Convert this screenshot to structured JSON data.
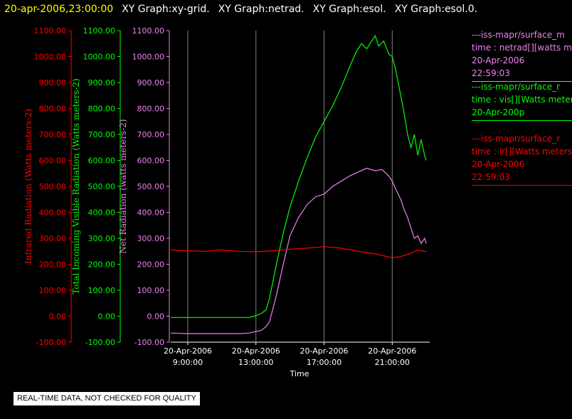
{
  "header": {
    "title": "20-apr-2006,23:00:00",
    "graph_names": [
      "XY Graph:xy-grid.",
      "XY Graph:netrad.",
      "XY Graph:esol.",
      "XY Graph:esol.0."
    ]
  },
  "colors": {
    "background": "#000000",
    "title": "#ffff00",
    "infrared": "#ff0000",
    "visible": "#00ff00",
    "net": "#ee82ee",
    "axis": "#ffffff",
    "grid": "#808080"
  },
  "chart_data": {
    "type": "line",
    "xlabel": "Time",
    "x_ticks": [
      {
        "date": "20-Apr-2006",
        "time": "9:00:00"
      },
      {
        "date": "20-Apr-2006",
        "time": "13:00:00"
      },
      {
        "date": "20-Apr-2006",
        "time": "17:00:00"
      },
      {
        "date": "20-Apr-2006",
        "time": "21:00:00"
      }
    ],
    "x_range_hours": [
      8.0,
      23.2
    ],
    "y_axes": [
      {
        "label": "Infrared Radiation (Watts meters-2)",
        "color": "#ff0000",
        "ylim": [
          -100,
          1100
        ]
      },
      {
        "label": "Total Incoming Visible Radiation (Watts meters-2)",
        "color": "#00ff00",
        "ylim": [
          -100,
          1100
        ]
      },
      {
        "label": "Net Radiation (watts meters-2)",
        "color": "#ee82ee",
        "ylim": [
          -100,
          1100
        ]
      }
    ],
    "y_tick_labels": [
      "1100.00",
      "1000.00",
      "900.00",
      "800.00",
      "700.00",
      "600.00",
      "500.00",
      "400.00",
      "300.00",
      "200.00",
      "100.00",
      "0.00",
      "-100.00"
    ],
    "grid": "vertical lines at x ticks",
    "series": [
      {
        "name": "vis",
        "color": "#00ff00",
        "points": [
          [
            8.0,
            -5
          ],
          [
            9,
            -5
          ],
          [
            10,
            -5
          ],
          [
            11,
            -5
          ],
          [
            12,
            -5
          ],
          [
            12.6,
            -5
          ],
          [
            12.9,
            0
          ],
          [
            13.3,
            10
          ],
          [
            13.6,
            25
          ],
          [
            13.8,
            70
          ],
          [
            14.2,
            200
          ],
          [
            14.6,
            320
          ],
          [
            15,
            420
          ],
          [
            15.5,
            520
          ],
          [
            16,
            610
          ],
          [
            16.5,
            690
          ],
          [
            17,
            750
          ],
          [
            17.5,
            810
          ],
          [
            18,
            880
          ],
          [
            18.5,
            960
          ],
          [
            18.9,
            1020
          ],
          [
            19.2,
            1050
          ],
          [
            19.5,
            1030
          ],
          [
            19.8,
            1060
          ],
          [
            20.0,
            1080
          ],
          [
            20.2,
            1040
          ],
          [
            20.5,
            1060
          ],
          [
            20.8,
            1010
          ],
          [
            21.0,
            1000
          ],
          [
            21.2,
            950
          ],
          [
            21.5,
            850
          ],
          [
            21.7,
            780
          ],
          [
            21.9,
            700
          ],
          [
            22.1,
            650
          ],
          [
            22.3,
            700
          ],
          [
            22.5,
            620
          ],
          [
            22.7,
            680
          ],
          [
            22.9,
            620
          ],
          [
            23.0,
            600
          ]
        ]
      },
      {
        "name": "netrad",
        "color": "#ee82ee",
        "points": [
          [
            8.0,
            -65
          ],
          [
            9,
            -67
          ],
          [
            10,
            -67
          ],
          [
            11,
            -67
          ],
          [
            12,
            -67
          ],
          [
            12.6,
            -65
          ],
          [
            12.9,
            -60
          ],
          [
            13.3,
            -55
          ],
          [
            13.6,
            -40
          ],
          [
            13.8,
            -20
          ],
          [
            14.2,
            80
          ],
          [
            14.6,
            200
          ],
          [
            15,
            310
          ],
          [
            15.5,
            380
          ],
          [
            16,
            430
          ],
          [
            16.5,
            460
          ],
          [
            17,
            470
          ],
          [
            17.5,
            500
          ],
          [
            18,
            520
          ],
          [
            18.5,
            540
          ],
          [
            19,
            555
          ],
          [
            19.5,
            570
          ],
          [
            20,
            560
          ],
          [
            20.4,
            565
          ],
          [
            20.8,
            540
          ],
          [
            21.0,
            520
          ],
          [
            21.2,
            490
          ],
          [
            21.5,
            450
          ],
          [
            21.7,
            410
          ],
          [
            21.9,
            380
          ],
          [
            22.1,
            340
          ],
          [
            22.3,
            300
          ],
          [
            22.5,
            310
          ],
          [
            22.7,
            280
          ],
          [
            22.9,
            300
          ],
          [
            23.0,
            280
          ]
        ]
      },
      {
        "name": "ir",
        "color": "#ff0000",
        "points": [
          [
            8.0,
            255
          ],
          [
            9,
            252
          ],
          [
            10,
            250
          ],
          [
            11,
            255
          ],
          [
            12,
            250
          ],
          [
            13,
            248
          ],
          [
            14,
            252
          ],
          [
            15,
            258
          ],
          [
            16,
            262
          ],
          [
            17,
            268
          ],
          [
            18,
            262
          ],
          [
            19,
            250
          ],
          [
            20,
            240
          ],
          [
            21,
            225
          ],
          [
            21.5,
            230
          ],
          [
            22,
            240
          ],
          [
            22.5,
            255
          ],
          [
            23.0,
            248
          ]
        ]
      }
    ]
  },
  "legend": [
    {
      "color": "#ee82ee",
      "lines": [
        "---iss-mapr/surface_m",
        "time : netrad[][watts m",
        "20-Apr-2006",
        "22:59:03"
      ]
    },
    {
      "color": "#00ff00",
      "lines": [
        "---iss-mapr/surface_r",
        "time : vis[][Watts meter",
        "20-Apr-200p"
      ]
    },
    {
      "color": "#ff0000",
      "lines": [
        "---iss-mapr/surface_r",
        "time : ir[][Watts meters",
        "20-Apr-2006",
        "22:59:03"
      ]
    }
  ],
  "notice": "REAL-TIME DATA, NOT CHECKED FOR QUALITY"
}
